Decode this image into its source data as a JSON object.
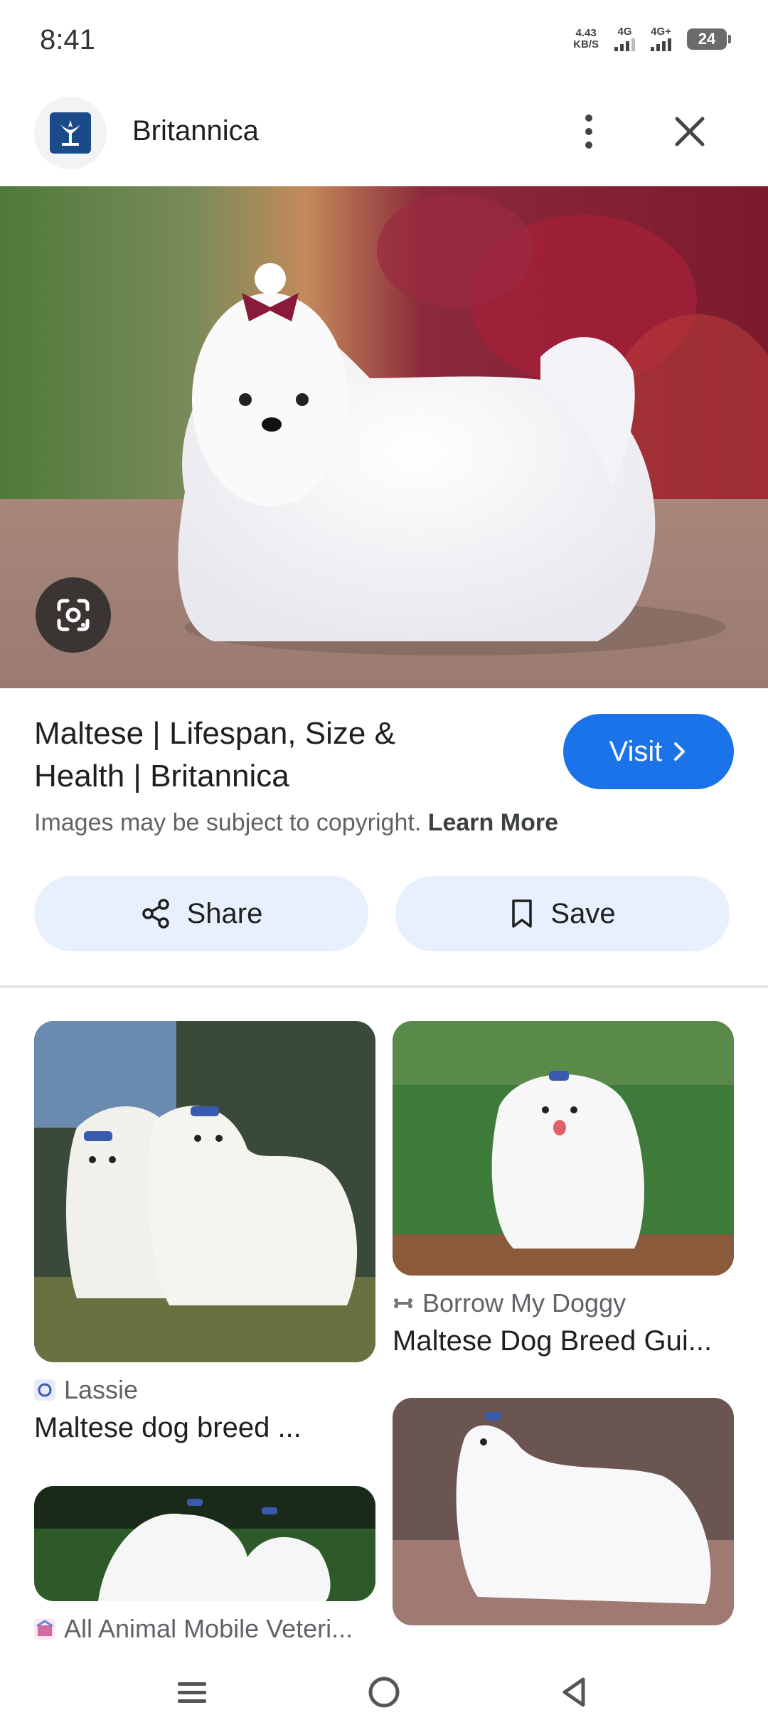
{
  "status_bar": {
    "time": "8:41",
    "net_speed_value": "4.43",
    "net_speed_unit": "KB/S",
    "signal1_label": "4G",
    "signal2_label": "4G+",
    "battery": "24"
  },
  "header": {
    "site_name": "Britannica"
  },
  "result": {
    "title": "Maltese | Lifespan, Size & Health | Britannica",
    "visit_label": "Visit",
    "copyright_text": "Images may be subject to copyright.",
    "learn_more": "Learn More",
    "share_label": "Share",
    "save_label": "Save"
  },
  "related": [
    {
      "source": "Lassie",
      "title": "Maltese dog breed ..."
    },
    {
      "source": "Borrow My Doggy",
      "title": "Maltese Dog Breed Gui..."
    },
    {
      "source": "All Animal Mobile Veteri...",
      "title": ""
    },
    {
      "source": "",
      "title": ""
    }
  ],
  "colors": {
    "accent": "#1a73e8",
    "button_bg": "#e8f0fe",
    "britannica_blue": "#1a4a8a"
  }
}
